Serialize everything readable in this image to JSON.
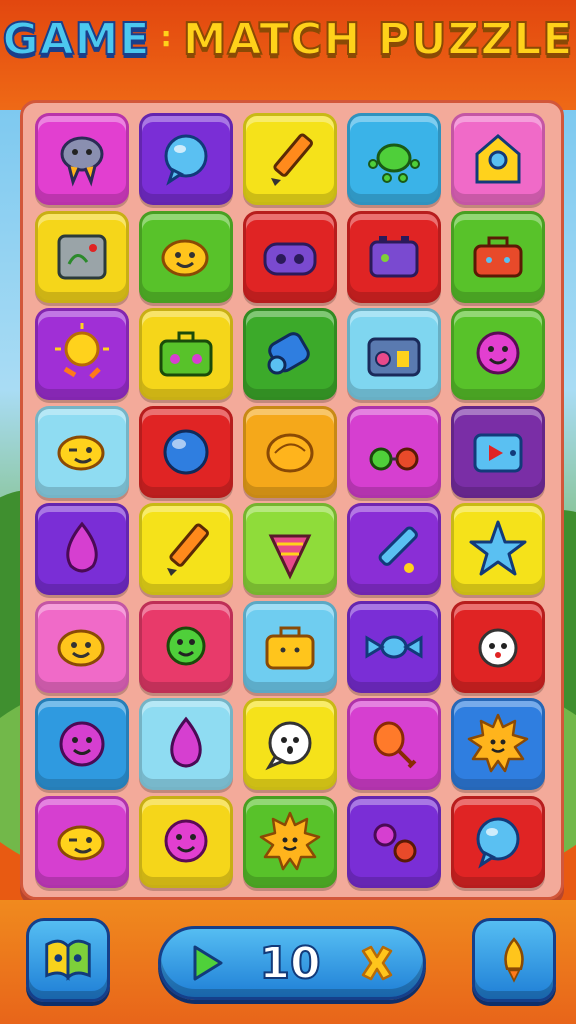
{
  "title": {
    "word1": "GAME",
    "separator": ":",
    "word2": "MATCH PUZZLE"
  },
  "colors": {
    "header": "#e2470f",
    "board": "#f3aa9a",
    "button": "#2f95e0"
  },
  "board": {
    "rows": 8,
    "cols": 5,
    "tiles": [
      {
        "color": "#e23fd0",
        "icon": "creature"
      },
      {
        "color": "#7a2ed6",
        "icon": "speech-bubble"
      },
      {
        "color": "#f5e21a",
        "icon": "pencil"
      },
      {
        "color": "#3ab3e8",
        "icon": "frog"
      },
      {
        "color": "#f06ac8",
        "icon": "house"
      },
      {
        "color": "#f5d61a",
        "icon": "gadget"
      },
      {
        "color": "#58c22a",
        "icon": "smiley"
      },
      {
        "color": "#e02424",
        "icon": "robot-face"
      },
      {
        "color": "#e02424",
        "icon": "battery"
      },
      {
        "color": "#58c22a",
        "icon": "toolbox"
      },
      {
        "color": "#a02fd6",
        "icon": "sun"
      },
      {
        "color": "#f5d61a",
        "icon": "suitcase"
      },
      {
        "color": "#3caa2a",
        "icon": "can"
      },
      {
        "color": "#7fd6f0",
        "icon": "radio"
      },
      {
        "color": "#58c22a",
        "icon": "blob-face"
      },
      {
        "color": "#8fdcf2",
        "icon": "wink-face"
      },
      {
        "color": "#e02424",
        "icon": "orb"
      },
      {
        "color": "#f5a81a",
        "icon": "bread"
      },
      {
        "color": "#d63fd0",
        "icon": "glasses"
      },
      {
        "color": "#7a2ea6",
        "icon": "tv"
      },
      {
        "color": "#7a2ed6",
        "icon": "drop"
      },
      {
        "color": "#f5e21a",
        "icon": "pencil"
      },
      {
        "color": "#8fdc3a",
        "icon": "ice-cream"
      },
      {
        "color": "#8a2ed6",
        "icon": "brush"
      },
      {
        "color": "#f5e21a",
        "icon": "star"
      },
      {
        "color": "#f06ac8",
        "icon": "smiley"
      },
      {
        "color": "#e83a6a",
        "icon": "turtle"
      },
      {
        "color": "#6fcdf0",
        "icon": "bag"
      },
      {
        "color": "#7a2ed6",
        "icon": "candy"
      },
      {
        "color": "#e02424",
        "icon": "ghost"
      },
      {
        "color": "#2f9ae0",
        "icon": "ball-face"
      },
      {
        "color": "#8fdcf2",
        "icon": "drop"
      },
      {
        "color": "#f5e21a",
        "icon": "ghost-bubble"
      },
      {
        "color": "#d63fd0",
        "icon": "drumstick"
      },
      {
        "color": "#2f7ee0",
        "icon": "sun-face"
      },
      {
        "color": "#d63fd0",
        "icon": "wink-face"
      },
      {
        "color": "#f5d61a",
        "icon": "blob-face"
      },
      {
        "color": "#58c22a",
        "icon": "sun-face"
      },
      {
        "color": "#7a2ed6",
        "icon": "balls"
      },
      {
        "color": "#e02424",
        "icon": "speech-bubble"
      }
    ]
  },
  "footer": {
    "left_icon": "map-icon",
    "score": "10",
    "right_icon": "rocket-icon"
  }
}
